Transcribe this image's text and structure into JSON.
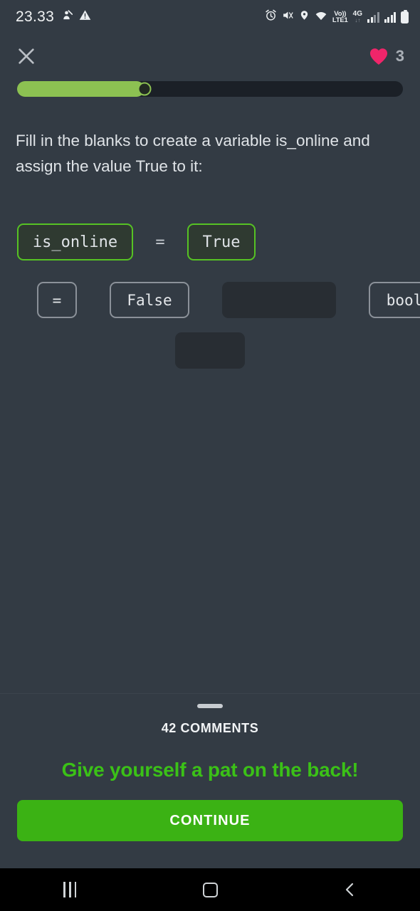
{
  "statusbar": {
    "time": "23.33",
    "left_icons": [
      "do-not-disturb-icon",
      "warning-triangle-icon"
    ],
    "right_icons": [
      "alarm-icon",
      "mute-vibrate-icon",
      "location-icon",
      "wifi-icon"
    ],
    "volte_label": "Vo))",
    "volte_sub": "LTE1",
    "network_label": "4G",
    "battery": "battery-icon"
  },
  "header": {
    "close_label": "close-icon",
    "heart_icon": "heart-icon",
    "hearts_count": "3"
  },
  "progress": {
    "percent": 33,
    "fill_color": "#8cc152",
    "track_color": "#1b2027"
  },
  "lesson": {
    "question": "Fill in the blanks to create a variable is_online and assign the value True to it:",
    "equation_operator": "=",
    "slots": [
      {
        "value": "is_online",
        "filled": true
      },
      {
        "value": "True",
        "filled": true
      }
    ],
    "word_bank_row1": [
      {
        "label": "=",
        "used": false
      },
      {
        "label": "False",
        "used": false
      },
      {
        "label": "",
        "used": true
      },
      {
        "label": "bool",
        "used": false
      }
    ],
    "word_bank_row2": [
      {
        "label": "",
        "used": true
      }
    ]
  },
  "bottom_sheet": {
    "handle": "drag-handle",
    "comments_label": "42 COMMENTS",
    "praise_text": "Give yourself a pat on the back!",
    "continue_label": "CONTINUE",
    "praise_color": "#3bc117",
    "continue_color": "#3bb214"
  },
  "navbar": {
    "recents_label": "recents-icon",
    "home_label": "home-icon",
    "back_label": "back-icon"
  }
}
